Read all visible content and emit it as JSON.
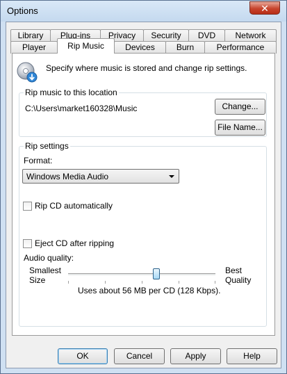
{
  "window": {
    "title": "Options",
    "close_glyph": "✕"
  },
  "tabs_row1": [
    "Library",
    "Plug-ins",
    "Privacy",
    "Security",
    "DVD",
    "Network"
  ],
  "tabs_row2": [
    "Player",
    "Rip Music",
    "Devices",
    "Burn",
    "Performance"
  ],
  "active_tab": "Rip Music",
  "description": "Specify where music is stored and change rip settings.",
  "location": {
    "title": "Rip music to this location",
    "path": "C:\\Users\\market160328\\Music",
    "change_label": "Change...",
    "filename_label": "File Name..."
  },
  "settings": {
    "title": "Rip settings",
    "format_label": "Format:",
    "format_value": "Windows Media Audio",
    "rip_auto_label": "Rip CD automatically",
    "rip_auto_checked": false,
    "eject_label": "Eject CD after ripping",
    "eject_checked": false,
    "quality_label": "Audio quality:",
    "smallest_line1": "Smallest",
    "smallest_line2": "Size",
    "best_line1": "Best",
    "best_line2": "Quality",
    "quality_fraction": 0.6,
    "quality_text": "Uses about 56 MB per CD (128 Kbps)."
  },
  "buttons": {
    "ok": "OK",
    "cancel": "Cancel",
    "apply": "Apply",
    "help": "Help"
  },
  "icons": {
    "cd": "cd-rip-icon",
    "close": "close-icon"
  }
}
